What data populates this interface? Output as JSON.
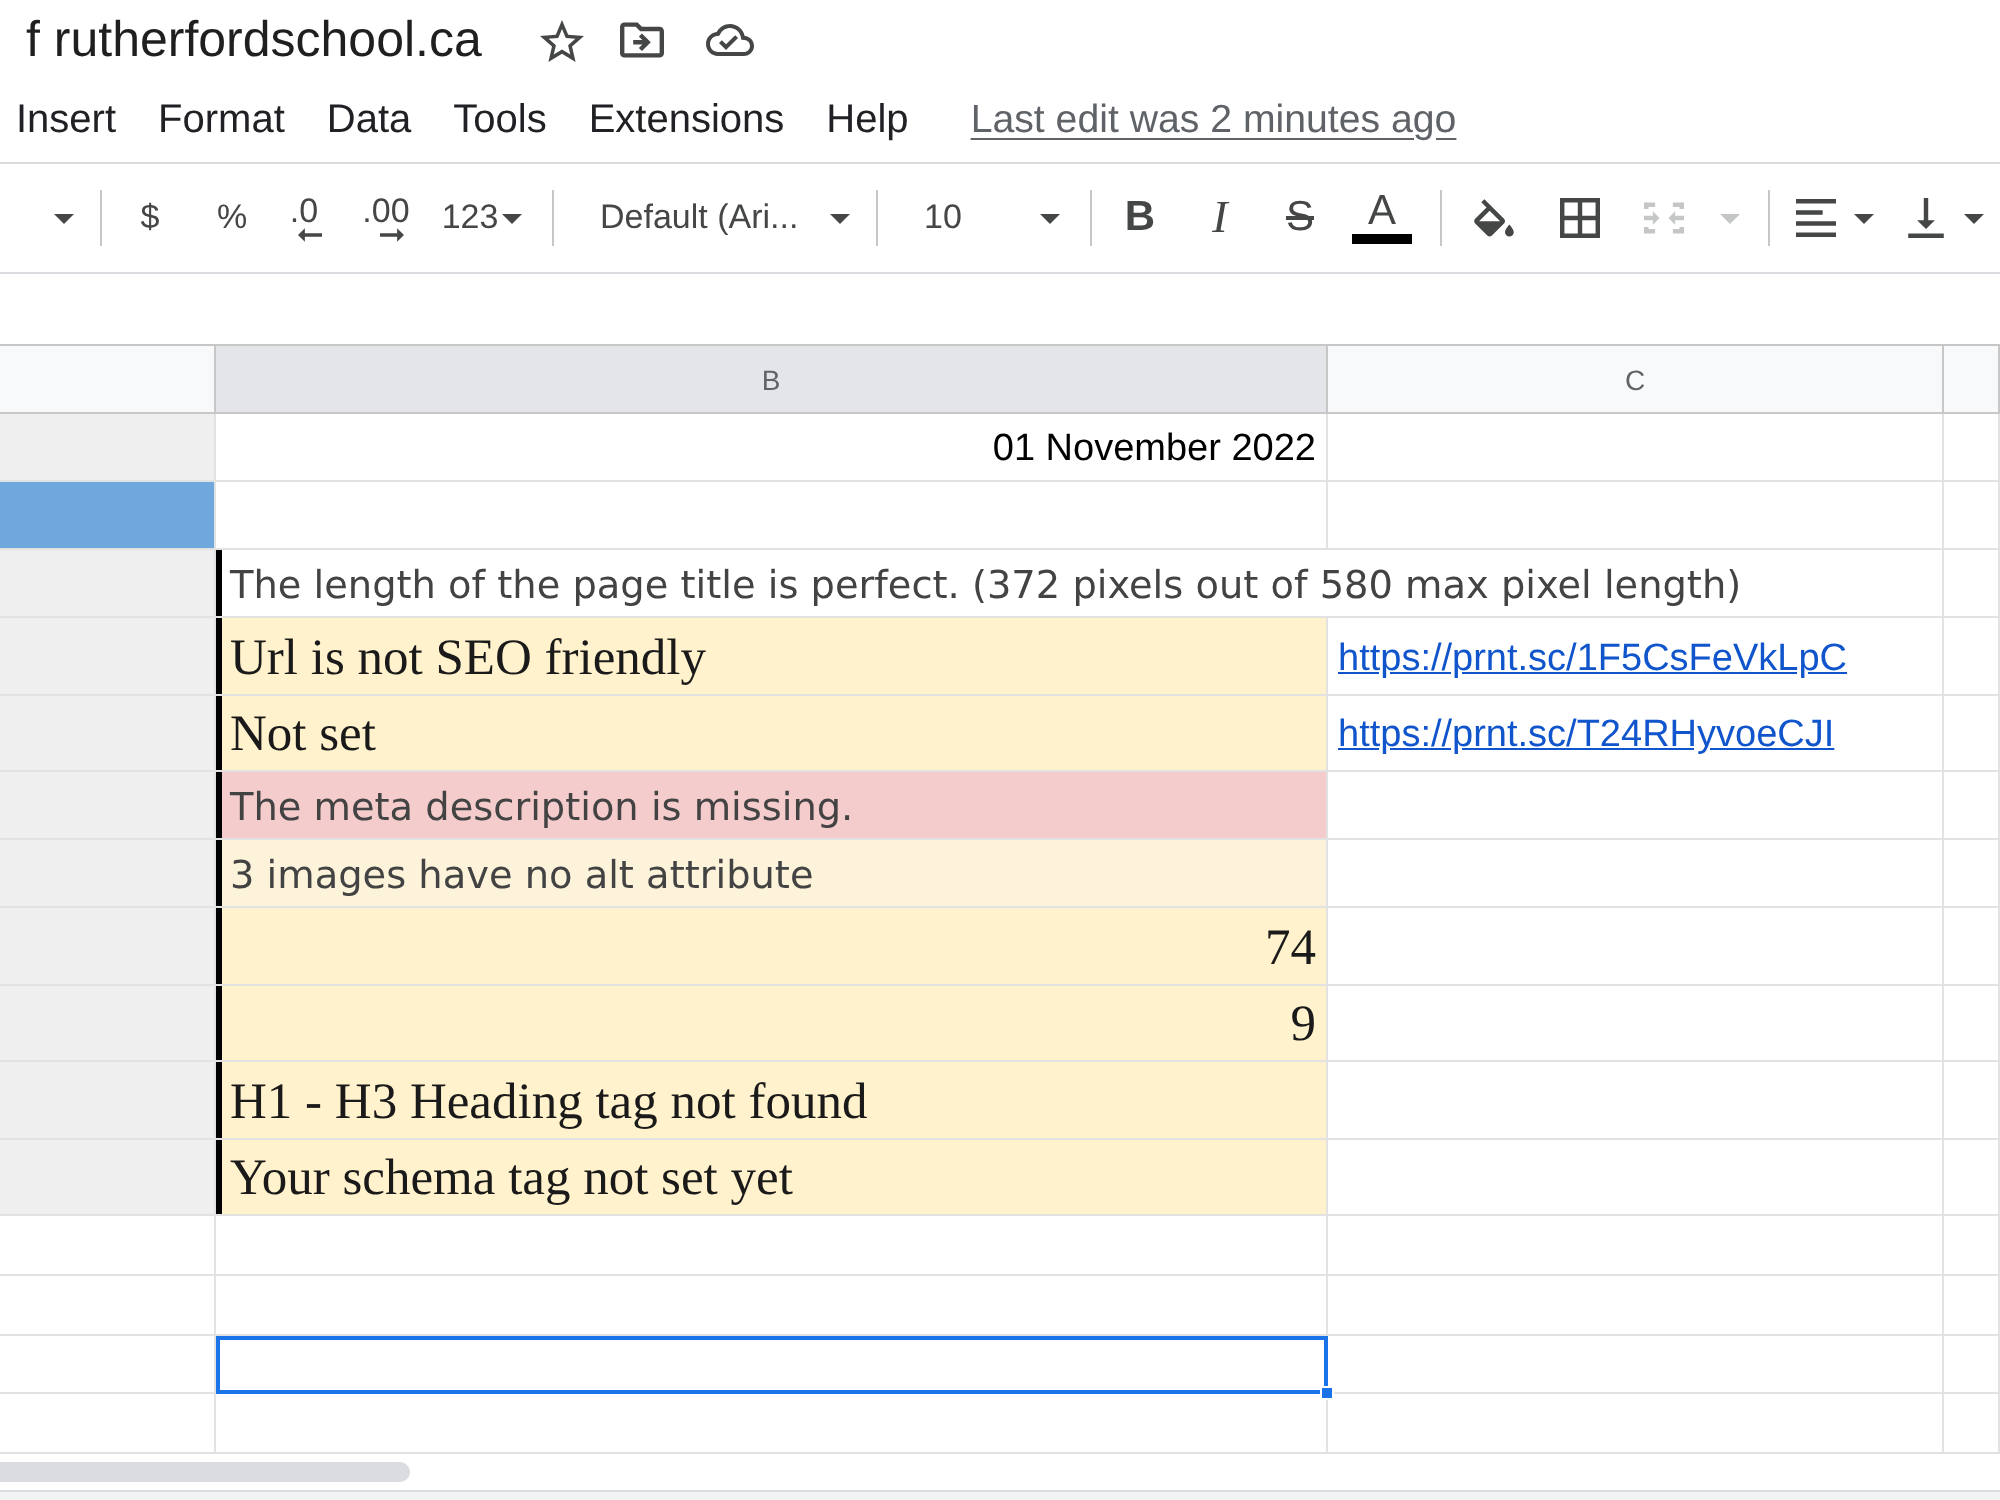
{
  "document": {
    "title": "f rutherfordschool.ca"
  },
  "menu": [
    "Insert",
    "Format",
    "Data",
    "Tools",
    "Extensions",
    "Help"
  ],
  "last_edit": "Last edit was 2 minutes ago",
  "toolbar": {
    "number_buttons": [
      "$",
      "%"
    ],
    "decimal_buttons": [
      ".0",
      ".00"
    ],
    "number_format": "123",
    "font": "Default (Ari...",
    "font_size": "10",
    "style_buttons": [
      {
        "label": "B",
        "kind": "bold"
      },
      {
        "label": "I",
        "kind": "italic"
      },
      {
        "label": "S",
        "kind": "strike"
      },
      {
        "label": "A",
        "kind": "color",
        "color": "#000000"
      }
    ],
    "merge_cells": {
      "disabled": true
    }
  },
  "columns": [
    {
      "label": "B",
      "selected": true
    },
    {
      "label": "C",
      "selected": false
    }
  ],
  "rows": [
    {
      "kind": "date",
      "column_a": {
        "color": "#efefef"
      },
      "text": "01 November 2022",
      "bordered": false,
      "selected": false
    },
    {
      "kind": "spacer",
      "column_a": {
        "color": "#6fa8dc"
      },
      "bordered": false,
      "selected": false
    },
    {
      "kind": "summary",
      "column_a": {
        "color": "#efefef"
      },
      "text": "The length of the page title is perfect. (372 pixels out of 580 max pixel length)",
      "bordered": true,
      "selected": false
    },
    {
      "kind": "finding",
      "column_a": {
        "color": "#efefef"
      },
      "text": "Url is not SEO friendly",
      "color": "#fff2cc",
      "link": "https://prnt.sc/1F5CsFeVkLpC",
      "bordered": true,
      "selected": false
    },
    {
      "kind": "finding",
      "column_a": {
        "color": "#efefef"
      },
      "text": "Not set",
      "color": "#fff2cc",
      "link": "https://prnt.sc/T24RHyvoeCJI",
      "bordered": true,
      "selected": false
    },
    {
      "kind": "summary",
      "column_a": {
        "color": "#efefef"
      },
      "text": "The meta description is missing.",
      "color": "#f4cccc",
      "bordered": true,
      "selected": false
    },
    {
      "kind": "summary",
      "column_a": {
        "color": "#efefef"
      },
      "text": "3 images have no alt attribute",
      "color": "#fdf3da",
      "bordered": true,
      "selected": false
    },
    {
      "kind": "count",
      "column_a": {
        "color": "#efefef"
      },
      "text": "74",
      "color": "#fff2cc",
      "bordered": true,
      "selected": false
    },
    {
      "kind": "count",
      "column_a": {
        "color": "#efefef"
      },
      "text": "9",
      "color": "#fff2cc",
      "bordered": true,
      "selected": false
    },
    {
      "kind": "finding",
      "column_a": {
        "color": "#efefef"
      },
      "text": "H1 - H3 Heading tag not found",
      "color": "#fff2cc",
      "bordered": true,
      "selected": false
    },
    {
      "kind": "finding",
      "column_a": {
        "color": "#efefef"
      },
      "text": "Your schema tag not set yet",
      "color": "#fff2cc",
      "bordered": true,
      "selected": false
    },
    {
      "kind": "empty",
      "bordered": false,
      "selected": false
    },
    {
      "kind": "empty",
      "bordered": false,
      "selected": false
    },
    {
      "kind": "empty",
      "bordered": false,
      "selected": true
    },
    {
      "kind": "empty",
      "bordered": false,
      "selected": false
    }
  ]
}
